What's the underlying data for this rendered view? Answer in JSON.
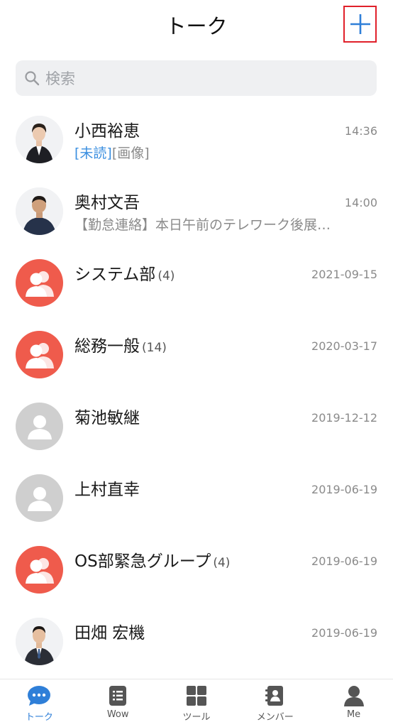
{
  "header": {
    "title": "トーク",
    "add_icon": "plus-icon"
  },
  "search": {
    "placeholder": "検索",
    "icon": "search-icon"
  },
  "chats": [
    {
      "name": "小西裕恵",
      "time": "14:36",
      "unread_tag": "[未読]",
      "preview": "[画像]",
      "count": "",
      "avatar": "photo-woman"
    },
    {
      "name": "奥村文吾",
      "time": "14:00",
      "unread_tag": "",
      "preview": "【勤怠連絡】本日午前のテレワーク後展…",
      "count": "",
      "avatar": "photo-man"
    },
    {
      "name": "システム部",
      "time": "2021-09-15",
      "unread_tag": "",
      "preview": "",
      "count": "(4)",
      "avatar": "group"
    },
    {
      "name": "総務一般",
      "time": "2020-03-17",
      "unread_tag": "",
      "preview": "",
      "count": "(14)",
      "avatar": "group"
    },
    {
      "name": "菊池敏継",
      "time": "2019-12-12",
      "unread_tag": "",
      "preview": "",
      "count": "",
      "avatar": "default"
    },
    {
      "name": "上村直幸",
      "time": "2019-06-19",
      "unread_tag": "",
      "preview": "",
      "count": "",
      "avatar": "default"
    },
    {
      "name": "OS部緊急グループ",
      "time": "2019-06-19",
      "unread_tag": "",
      "preview": "",
      "count": "(4)",
      "avatar": "group"
    },
    {
      "name": "田畑 宏機",
      "time": "2019-06-19",
      "unread_tag": "",
      "preview": "",
      "count": "",
      "avatar": "photo-man-suit"
    }
  ],
  "tabs": [
    {
      "label": "トーク",
      "icon": "chat-bubble-icon",
      "active": true
    },
    {
      "label": "Wow",
      "icon": "wow-icon",
      "active": false
    },
    {
      "label": "ツール",
      "icon": "grid-icon",
      "active": false
    },
    {
      "label": "メンバー",
      "icon": "contacts-icon",
      "active": false
    },
    {
      "label": "Me",
      "icon": "person-icon",
      "active": false
    }
  ],
  "colors": {
    "accent": "#2f7fd8",
    "group_avatar": "#ef5b4c",
    "highlight_box": "#e0202a",
    "unread": "#3b8fe0"
  }
}
